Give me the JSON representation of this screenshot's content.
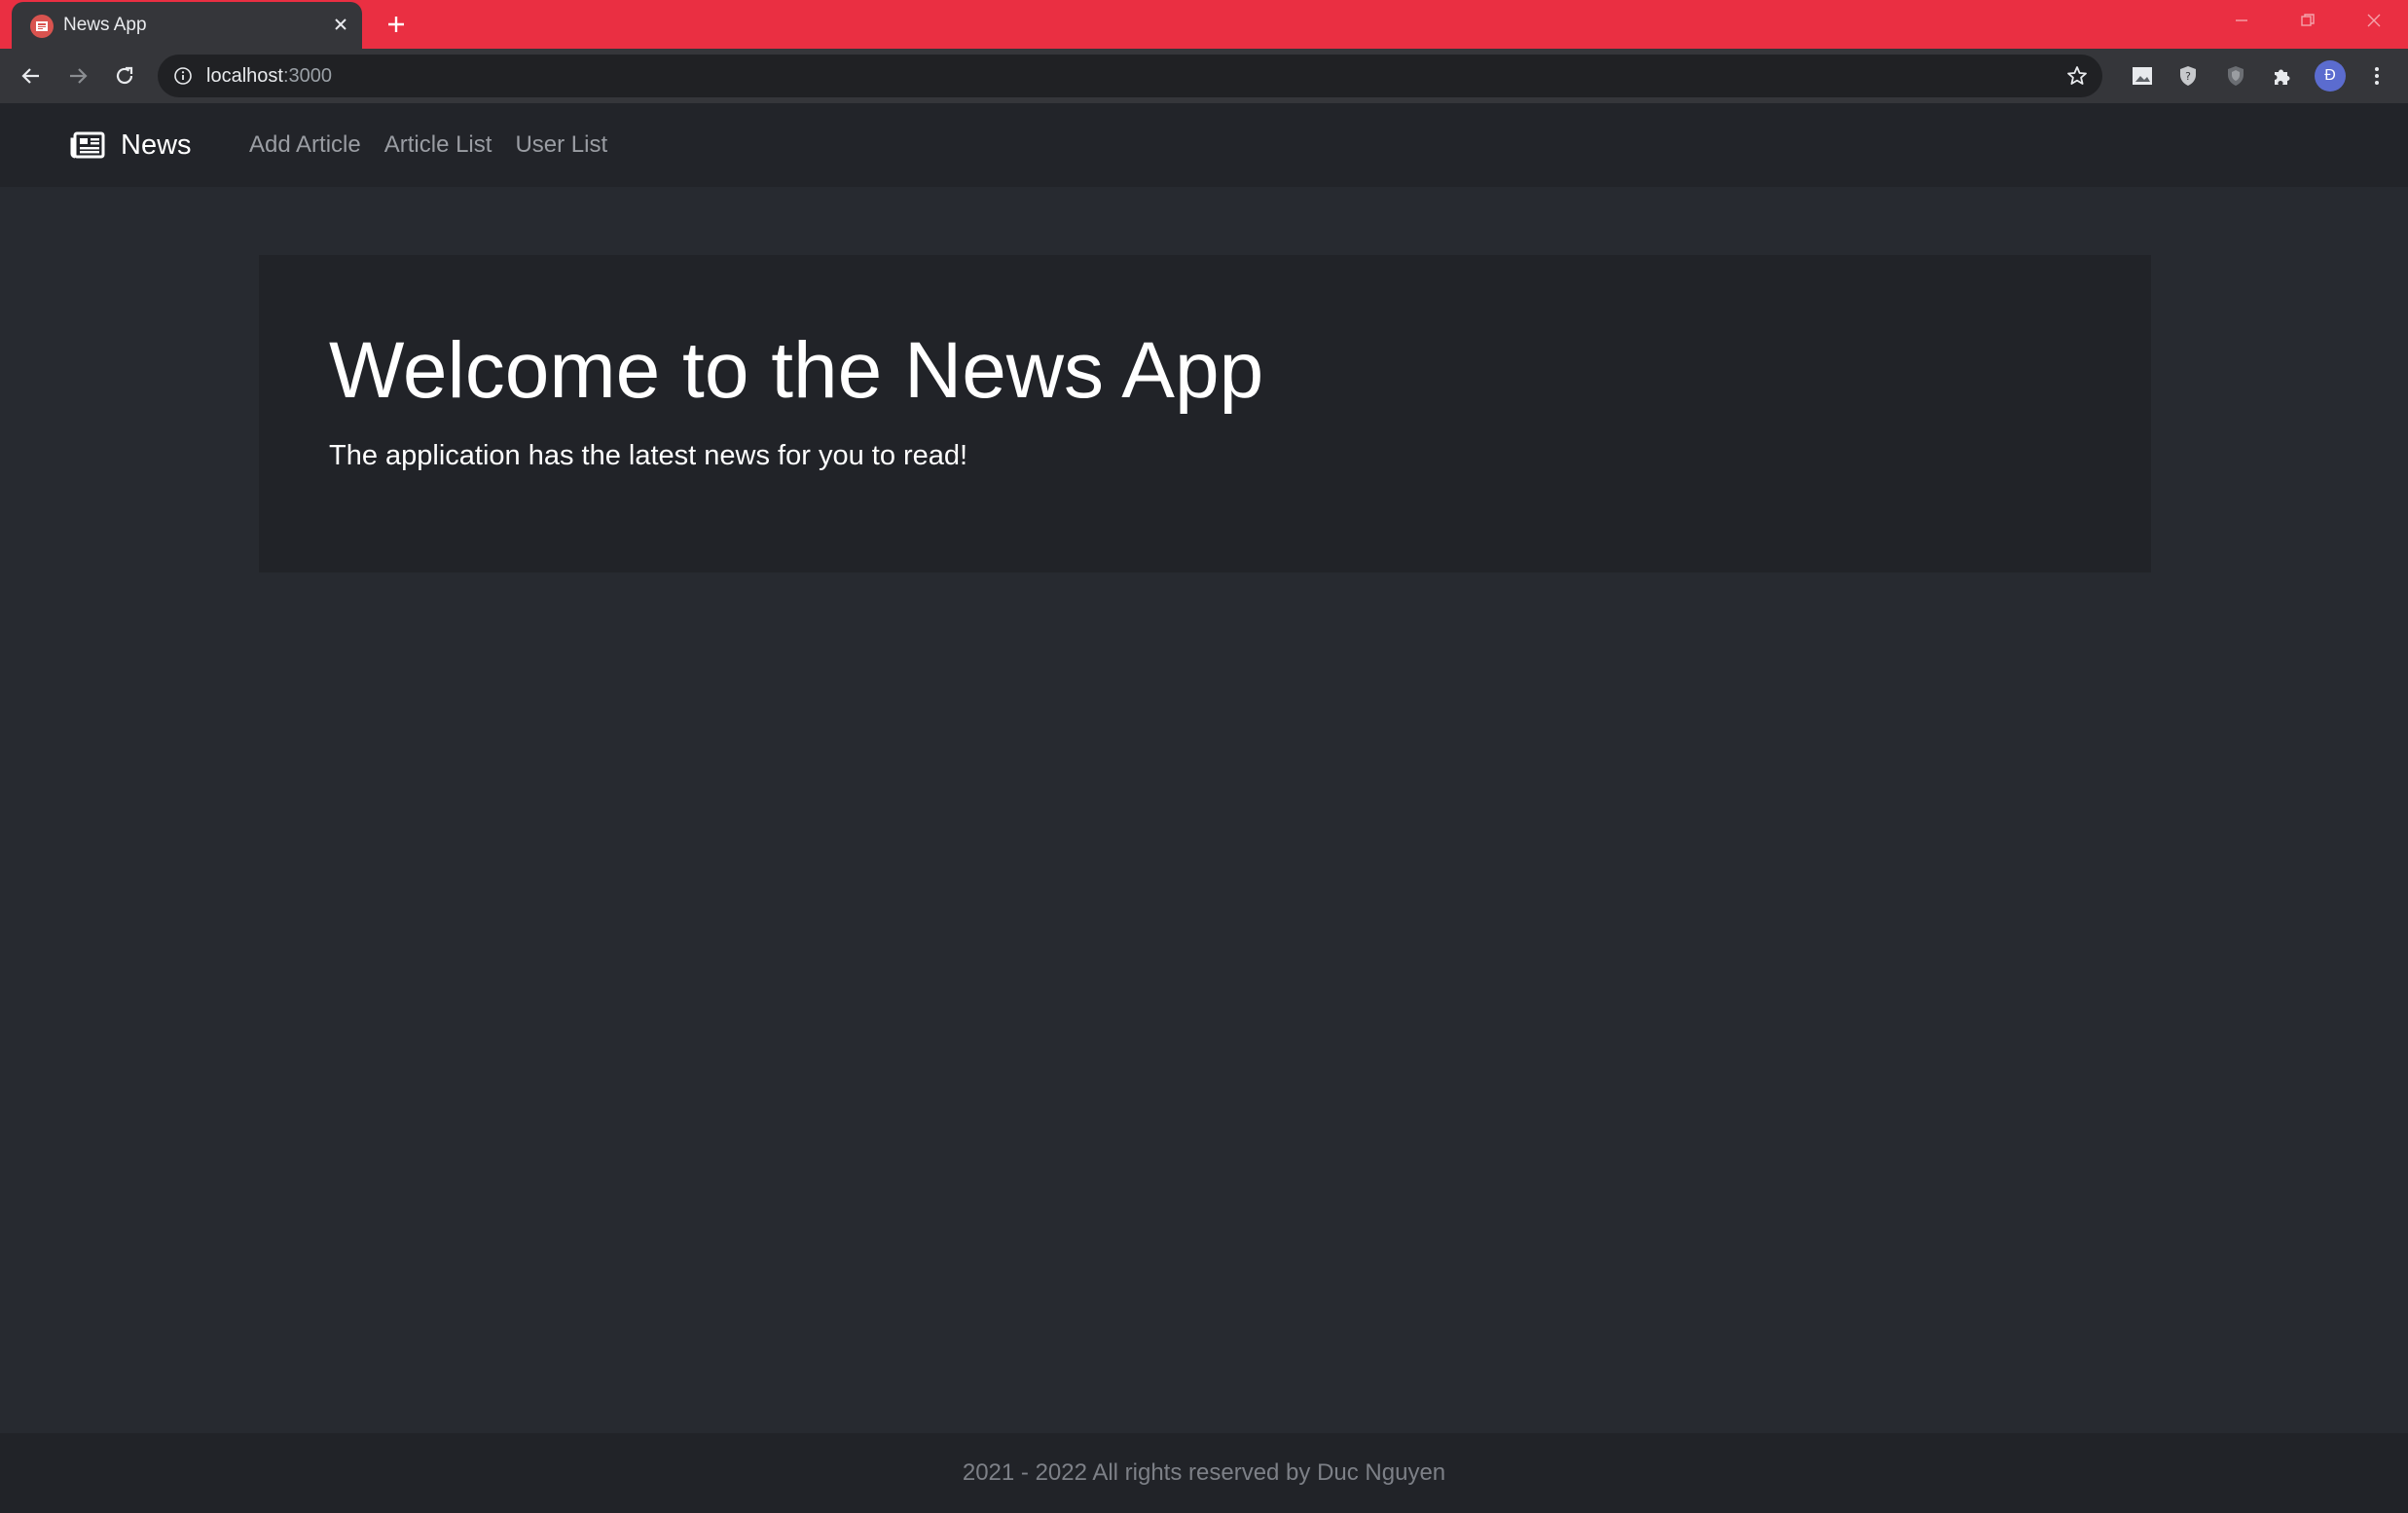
{
  "browser": {
    "tab_title": "News App",
    "url_host": "localhost",
    "url_port": ":3000",
    "avatar_initial": "Đ",
    "accent_color": "#ea2f42"
  },
  "navbar": {
    "brand": "News",
    "brand_icon": "newspaper-icon",
    "links": [
      "Add Article",
      "Article List",
      "User List"
    ]
  },
  "hero": {
    "title": "Welcome to the News App",
    "lead": "The application has the latest news for you to read!"
  },
  "footer": {
    "text": "2021 - 2022 All rights reserved by Duc Nguyen"
  }
}
